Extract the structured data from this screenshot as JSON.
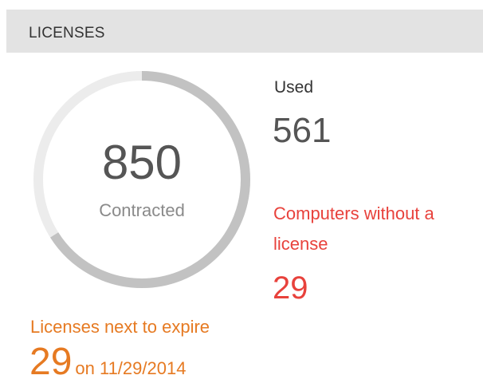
{
  "panel": {
    "title": "LICENSES"
  },
  "gauge": {
    "contracted_value": "850",
    "contracted_label": "Contracted",
    "used_fraction": 0.66,
    "track_color": "#ececec",
    "fill_color": "#c2c2c2"
  },
  "used": {
    "label": "Used",
    "value": "561"
  },
  "without_license": {
    "label": "Computers without a license",
    "value": "29",
    "color": "#e8423c"
  },
  "expiring": {
    "label": "Licenses next to expire",
    "value": "29",
    "date_text": "on 11/29/2014",
    "color": "#e67a22"
  }
}
